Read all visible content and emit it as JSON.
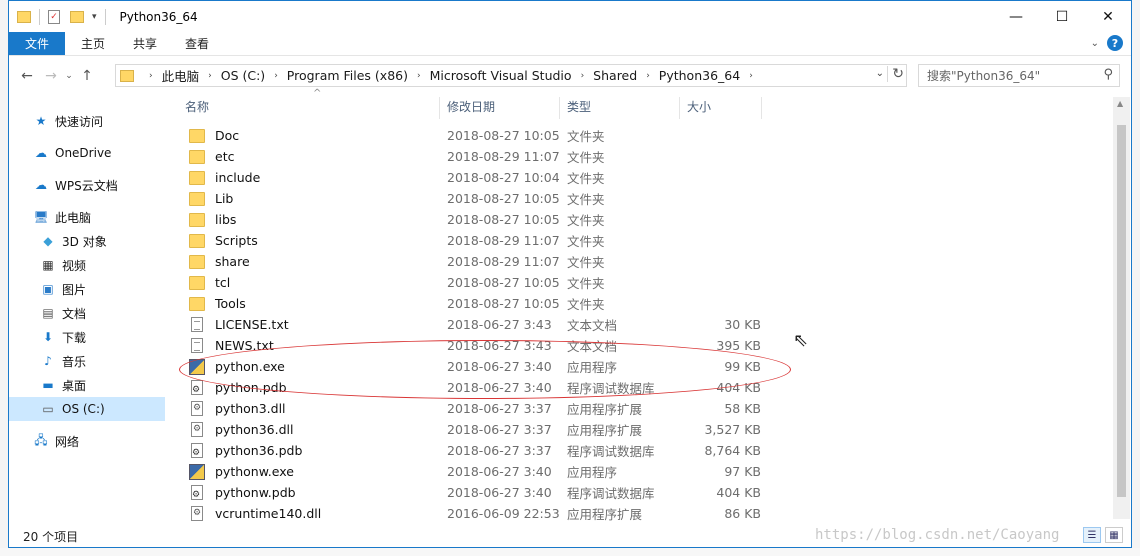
{
  "window": {
    "title": "Python36_64",
    "controls": [
      "minimize",
      "maximize",
      "close"
    ]
  },
  "ribbon": {
    "tabs": [
      "文件",
      "主页",
      "共享",
      "查看"
    ]
  },
  "address_bar": {
    "crumbs": [
      "此电脑",
      "OS (C:)",
      "Program Files (x86)",
      "Microsoft Visual Studio",
      "Shared",
      "Python36_64"
    ],
    "search_placeholder": "搜索\"Python36_64\""
  },
  "nav_pane": {
    "items": [
      {
        "label": "快速访问",
        "icon": "star-icon"
      },
      {
        "label": "OneDrive",
        "icon": "cloud-icon"
      },
      {
        "label": "WPS云文档",
        "icon": "cloud-outline-icon"
      },
      {
        "label": "此电脑",
        "icon": "computer-icon"
      },
      {
        "label": "3D 对象",
        "icon": "cube-icon"
      },
      {
        "label": "视频",
        "icon": "video-icon"
      },
      {
        "label": "图片",
        "icon": "picture-icon"
      },
      {
        "label": "文档",
        "icon": "document-icon"
      },
      {
        "label": "下载",
        "icon": "download-icon"
      },
      {
        "label": "音乐",
        "icon": "music-icon"
      },
      {
        "label": "桌面",
        "icon": "desktop-icon"
      },
      {
        "label": "OS (C:)",
        "icon": "drive-icon"
      },
      {
        "label": "网络",
        "icon": "network-icon"
      }
    ]
  },
  "columns": {
    "name": "名称",
    "date": "修改日期",
    "type": "类型",
    "size": "大小"
  },
  "files": [
    {
      "name": "Doc",
      "date": "2018-08-27 10:05",
      "type": "文件夹",
      "size": "",
      "icon": "folder-icon"
    },
    {
      "name": "etc",
      "date": "2018-08-29 11:07",
      "type": "文件夹",
      "size": "",
      "icon": "folder-icon"
    },
    {
      "name": "include",
      "date": "2018-08-27 10:04",
      "type": "文件夹",
      "size": "",
      "icon": "folder-icon"
    },
    {
      "name": "Lib",
      "date": "2018-08-27 10:05",
      "type": "文件夹",
      "size": "",
      "icon": "folder-icon"
    },
    {
      "name": "libs",
      "date": "2018-08-27 10:05",
      "type": "文件夹",
      "size": "",
      "icon": "folder-icon"
    },
    {
      "name": "Scripts",
      "date": "2018-08-29 11:07",
      "type": "文件夹",
      "size": "",
      "icon": "folder-icon"
    },
    {
      "name": "share",
      "date": "2018-08-29 11:07",
      "type": "文件夹",
      "size": "",
      "icon": "folder-icon"
    },
    {
      "name": "tcl",
      "date": "2018-08-27 10:05",
      "type": "文件夹",
      "size": "",
      "icon": "folder-icon"
    },
    {
      "name": "Tools",
      "date": "2018-08-27 10:05",
      "type": "文件夹",
      "size": "",
      "icon": "folder-icon"
    },
    {
      "name": "LICENSE.txt",
      "date": "2018-06-27 3:43",
      "type": "文本文档",
      "size": "30 KB",
      "icon": "text-file-icon"
    },
    {
      "name": "NEWS.txt",
      "date": "2018-06-27 3:43",
      "type": "文本文档",
      "size": "395 KB",
      "icon": "text-file-icon"
    },
    {
      "name": "python.exe",
      "date": "2018-06-27 3:40",
      "type": "应用程序",
      "size": "99 KB",
      "icon": "python-exe-icon"
    },
    {
      "name": "python.pdb",
      "date": "2018-06-27 3:40",
      "type": "程序调试数据库",
      "size": "404 KB",
      "icon": "pdb-file-icon"
    },
    {
      "name": "python3.dll",
      "date": "2018-06-27 3:37",
      "type": "应用程序扩展",
      "size": "58 KB",
      "icon": "dll-file-icon"
    },
    {
      "name": "python36.dll",
      "date": "2018-06-27 3:37",
      "type": "应用程序扩展",
      "size": "3,527 KB",
      "icon": "dll-file-icon"
    },
    {
      "name": "python36.pdb",
      "date": "2018-06-27 3:37",
      "type": "程序调试数据库",
      "size": "8,764 KB",
      "icon": "pdb-file-icon"
    },
    {
      "name": "pythonw.exe",
      "date": "2018-06-27 3:40",
      "type": "应用程序",
      "size": "97 KB",
      "icon": "python-exe-icon"
    },
    {
      "name": "pythonw.pdb",
      "date": "2018-06-27 3:40",
      "type": "程序调试数据库",
      "size": "404 KB",
      "icon": "pdb-file-icon"
    },
    {
      "name": "vcruntime140.dll",
      "date": "2016-06-09 22:53",
      "type": "应用程序扩展",
      "size": "86 KB",
      "icon": "dll-file-icon"
    }
  ],
  "status": {
    "item_count": "20 个项目"
  },
  "watermark": "https://blog.csdn.net/Caoyang"
}
